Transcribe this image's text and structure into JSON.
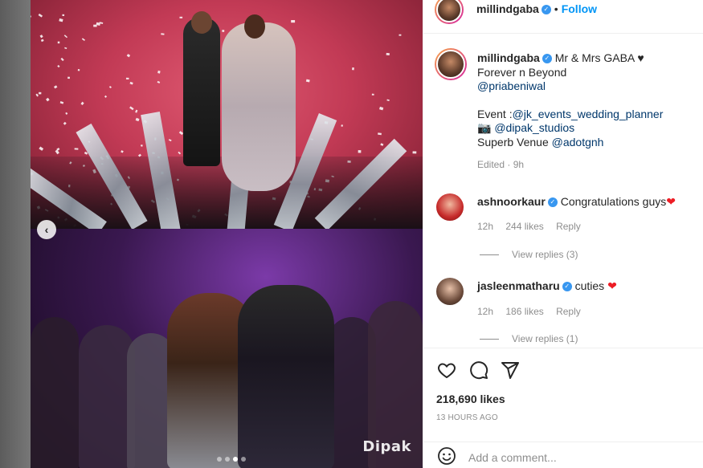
{
  "header": {
    "username": "millindgaba",
    "separator": "•",
    "follow_label": "Follow"
  },
  "caption": {
    "username": "millindgaba",
    "line1": "Mr & Mrs GABA ♥",
    "line2": "Forever n Beyond",
    "mention1": "@priabeniwal",
    "event_prefix": "Event :",
    "event_mention": "@jk_events_wedding_planner",
    "camera_emoji": "📷",
    "studio_mention": "@dipak_studios",
    "venue_prefix": "Superb Venue ",
    "venue_mention": "@adotgnh",
    "edited": "Edited · 9h"
  },
  "comments": [
    {
      "username": "ashnoorkaur",
      "text": "Congratulations guys",
      "heart": "❤",
      "time": "12h",
      "likes": "244 likes",
      "reply": "Reply",
      "view_replies": "View replies (3)"
    },
    {
      "username": "jasleenmatharu",
      "text": "cuties",
      "heart": "❤",
      "time": "12h",
      "likes": "186 likes",
      "reply": "Reply",
      "view_replies": "View replies (1)"
    }
  ],
  "actions": {
    "likes": "218,690 likes",
    "timeago": "13 HOURS AGO"
  },
  "add_comment": {
    "placeholder": "Add a comment..."
  },
  "media": {
    "watermark": "Dipak",
    "nav_arrow": "‹",
    "carousel_index": 3,
    "carousel_count": 4
  },
  "icons": {
    "verified": "verified-badge-icon",
    "like": "heart-icon",
    "comment": "comment-icon",
    "share": "share-icon",
    "emoji": "emoji-icon"
  },
  "colors": {
    "accent": "#0095f6",
    "verified": "#3897f0",
    "heart": "#ed1c24",
    "muted": "#8e8e8e"
  }
}
